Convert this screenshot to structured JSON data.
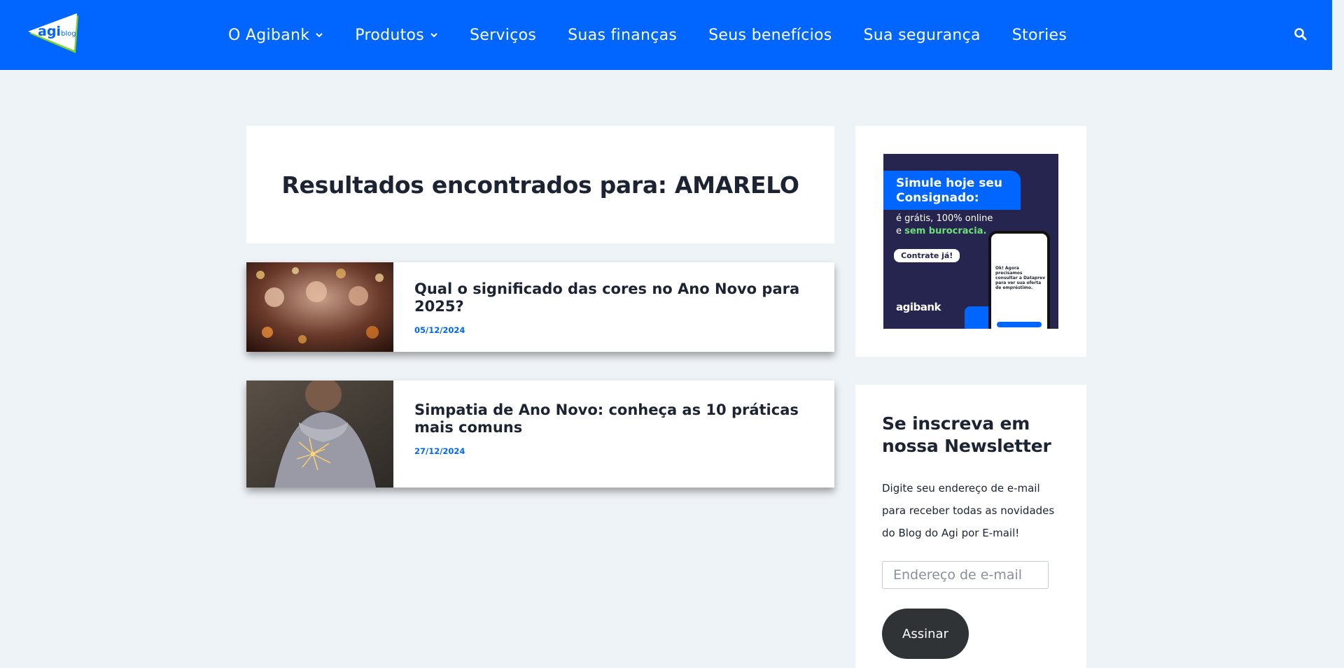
{
  "header": {
    "logo_text_main": "agi",
    "logo_text_sub": "blog",
    "nav": [
      {
        "label": "O Agibank",
        "dropdown": true
      },
      {
        "label": "Produtos",
        "dropdown": true
      },
      {
        "label": "Serviços",
        "dropdown": false
      },
      {
        "label": "Suas finanças",
        "dropdown": false
      },
      {
        "label": "Seus benefícios",
        "dropdown": false
      },
      {
        "label": "Sua segurança",
        "dropdown": false
      },
      {
        "label": "Stories",
        "dropdown": false
      }
    ],
    "search_icon": "search-icon"
  },
  "main": {
    "results_title": "Resultados encontrados para: AMARELO",
    "posts": [
      {
        "title": "Qual o significado das cores no Ano Novo para 2025?",
        "date": "05/12/2024"
      },
      {
        "title": "Simpatia de Ano Novo: conheça as 10 práticas mais comuns",
        "date": "27/12/2024"
      }
    ]
  },
  "sidebar": {
    "ad": {
      "headline": "Simule hoje seu Consignado:",
      "sub_line1": "é grátis, 100% online",
      "sub_line2_prefix": "e ",
      "sub_line2_highlight": "sem burocracia.",
      "cta": "Contrate já!",
      "brand": "agibank",
      "phone_text": "Ok! Agora precisamos consultar a Dataprev para ver sua oferta de empréstimo."
    },
    "newsletter": {
      "title": "Se inscreva em nossa Newsletter",
      "description": "Digite seu endereço de e-mail para receber todas as novidades do Blog do Agi por E-mail!",
      "email_placeholder": "Endereço de e-mail",
      "button_label": "Assinar"
    }
  },
  "colors": {
    "brand_blue": "#0066ff",
    "page_bg": "#eef3f7",
    "ad_navy": "#25254f",
    "button_dark": "#2f3336",
    "logo_green": "#7ed321"
  }
}
